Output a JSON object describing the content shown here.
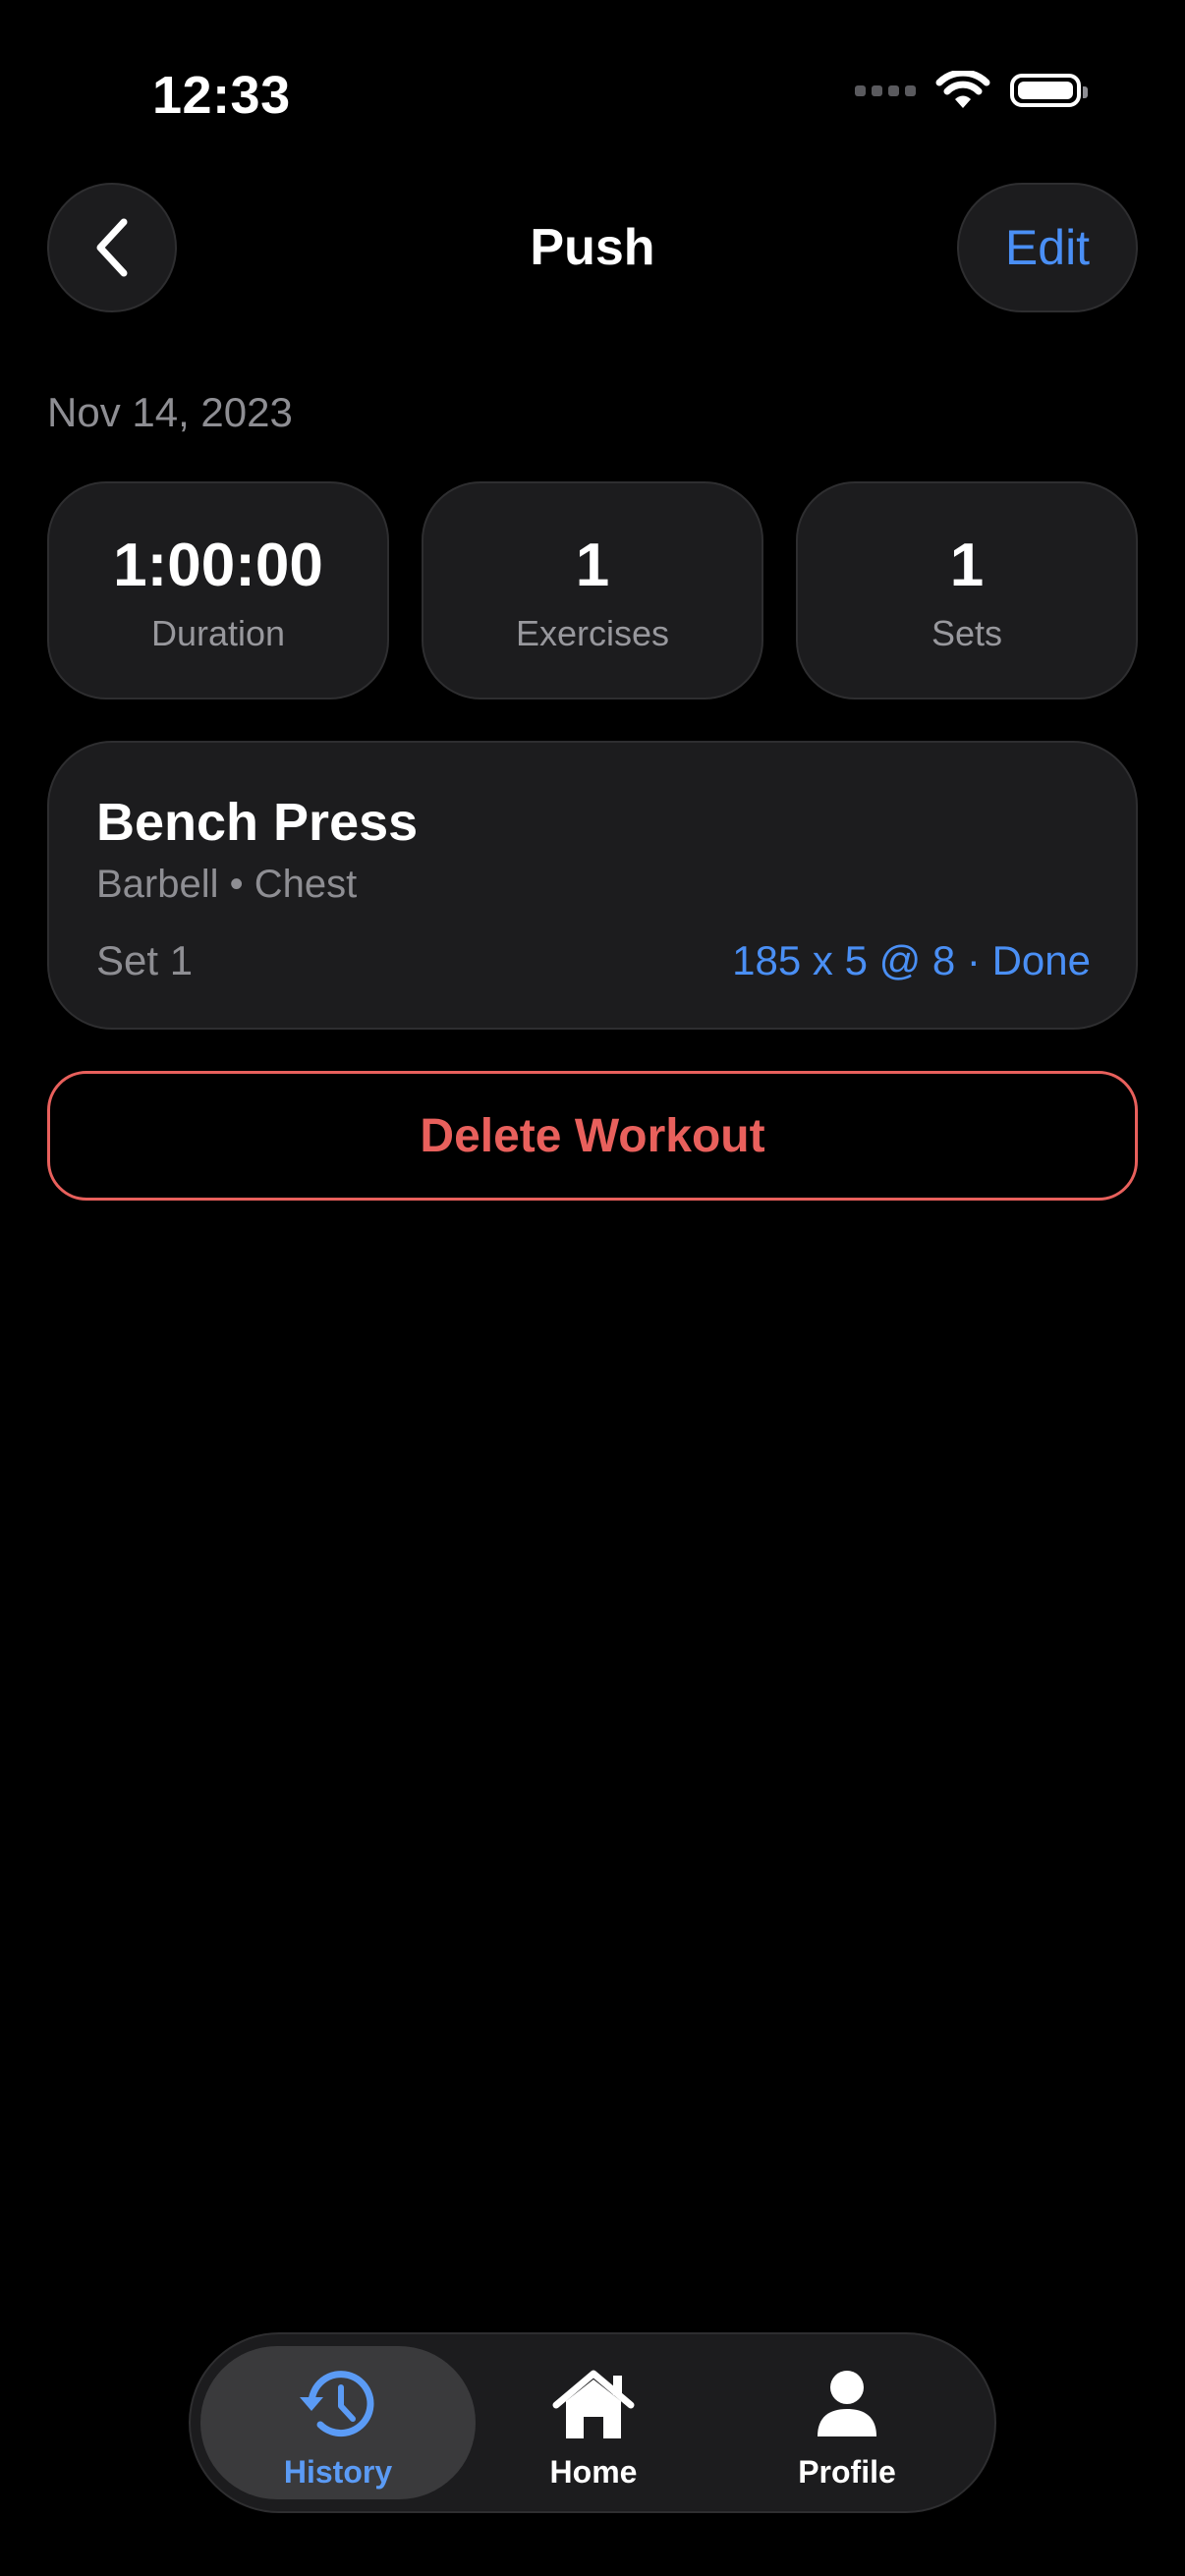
{
  "status_bar": {
    "time": "12:33"
  },
  "nav": {
    "title": "Push",
    "edit_label": "Edit"
  },
  "workout": {
    "date": "Nov 14, 2023",
    "stats": [
      {
        "value": "1:00:00",
        "label": "Duration"
      },
      {
        "value": "1",
        "label": "Exercises"
      },
      {
        "value": "1",
        "label": "Sets"
      }
    ],
    "exercise": {
      "name": "Bench Press",
      "meta": "Barbell • Chest",
      "set_label": "Set 1",
      "set_detail": "185 x 5 @ 8 · Done"
    },
    "delete_label": "Delete Workout"
  },
  "tab_bar": {
    "active": "History",
    "tabs": [
      {
        "label": "History",
        "icon": "history-icon"
      },
      {
        "label": "Home",
        "icon": "home-icon"
      },
      {
        "label": "Profile",
        "icon": "profile-icon"
      }
    ]
  },
  "colors": {
    "accent": "#4a8ff5",
    "destructive": "#e8605c",
    "card": "#1c1c1e",
    "background": "#000000"
  }
}
